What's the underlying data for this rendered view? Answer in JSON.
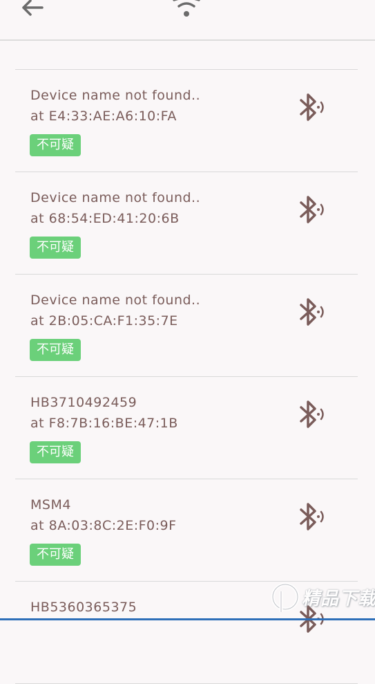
{
  "header": {
    "back_icon": "arrow-back-icon",
    "wifi_icon": "wifi-icon"
  },
  "devices": [
    {
      "name": "Device name not found..",
      "address": "at E4:33:AE:A6:10:FA",
      "badge": "不可疑",
      "icon": "bluetooth-searching-icon"
    },
    {
      "name": "Device name not found..",
      "address": "at 68:54:ED:41:20:6B",
      "badge": "不可疑",
      "icon": "bluetooth-searching-icon"
    },
    {
      "name": "Device name not found..",
      "address": "at 2B:05:CA:F1:35:7E",
      "badge": "不可疑",
      "icon": "bluetooth-searching-icon"
    },
    {
      "name": "HB3710492459",
      "address": "at F8:7B:16:BE:47:1B",
      "badge": "不可疑",
      "icon": "bluetooth-searching-icon"
    },
    {
      "name": "MSM4",
      "address": "at 8A:03:8C:2E:F0:9F",
      "badge": "不可疑",
      "icon": "bluetooth-searching-icon"
    },
    {
      "name": "HB5360365375",
      "address": "",
      "badge": "",
      "icon": "bluetooth-searching-icon"
    }
  ],
  "watermark": {
    "text": "精品下载"
  },
  "colors": {
    "text": "#7a5c5a",
    "badge": "#6bd07a",
    "icon": "#7a5c5a",
    "accent": "#2e6fb8"
  }
}
